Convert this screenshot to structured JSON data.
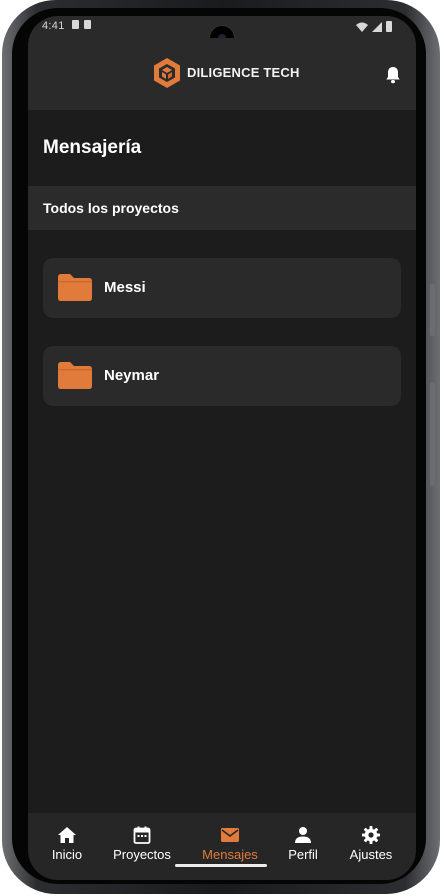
{
  "status_bar": {
    "time": "4:41"
  },
  "header": {
    "brand_name": "DILIGENCE TECH",
    "logo_icon": "diligence-cube-logo",
    "notification_icon": "bell-icon"
  },
  "page": {
    "title": "Mensajería",
    "section_label": "Todos los proyectos"
  },
  "folders": [
    {
      "label": "Messi",
      "icon": "folder-icon"
    },
    {
      "label": "Neymar",
      "icon": "folder-icon"
    }
  ],
  "bottom_nav": {
    "active": "Mensajes",
    "items": [
      {
        "label": "Inicio",
        "icon": "home-icon"
      },
      {
        "label": "Proyectos",
        "icon": "calendar-icon"
      },
      {
        "label": "Mensajes",
        "icon": "mail-icon"
      },
      {
        "label": "Perfil",
        "icon": "person-icon"
      },
      {
        "label": "Ajustes",
        "icon": "gear-icon"
      }
    ]
  },
  "colors": {
    "accent": "#e07b3c",
    "background": "#1c1c1c",
    "card": "#2a2a2a",
    "header": "#2a2a2a"
  }
}
